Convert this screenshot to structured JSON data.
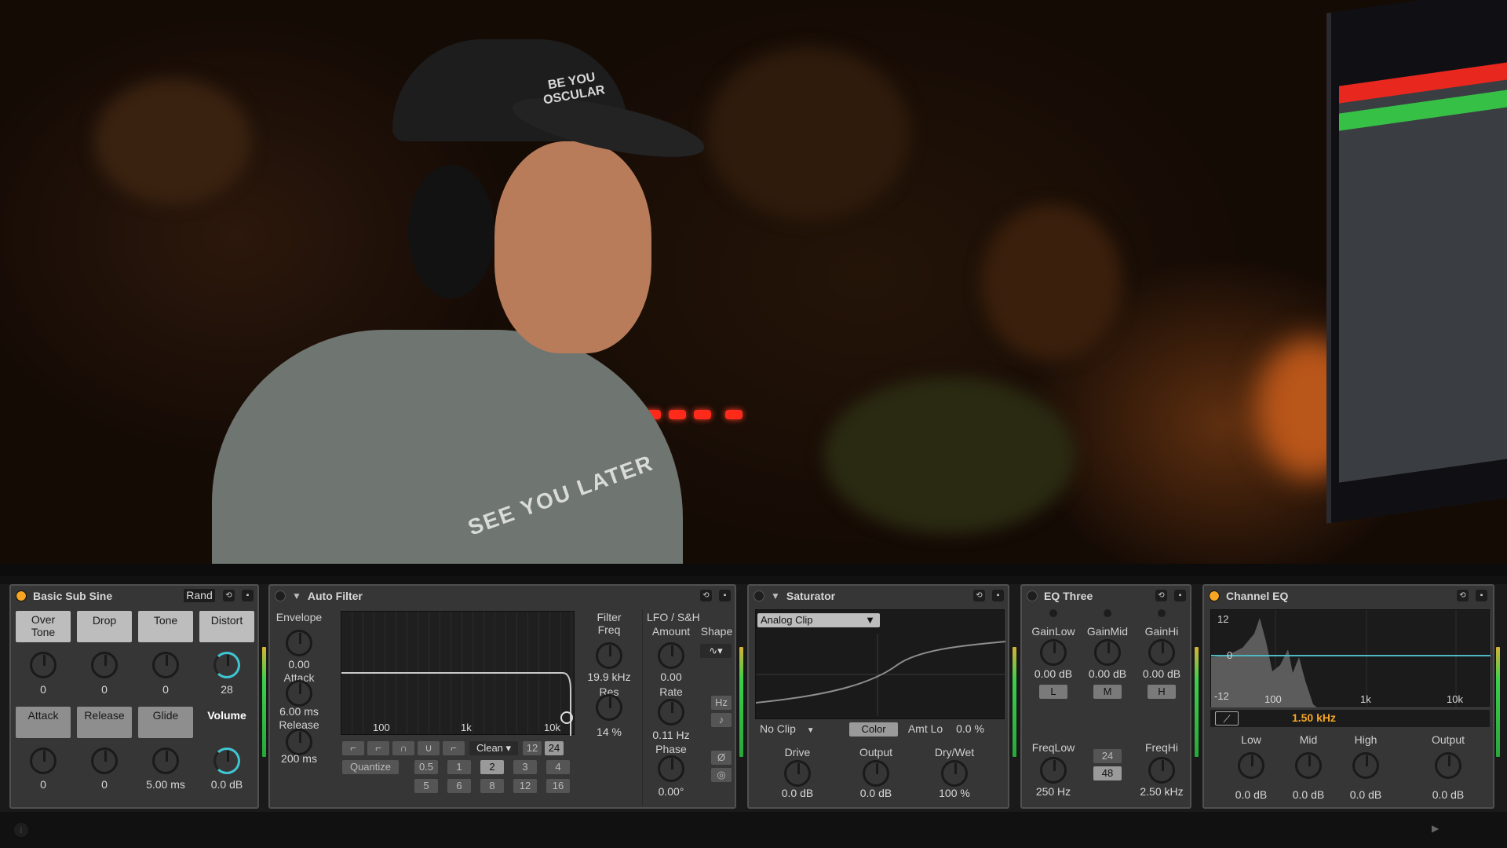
{
  "video": {
    "cap_text": "BE YOU\nOSCULAR",
    "shirt_text": "SEE YOU LATER"
  },
  "basic_sub_sine": {
    "title": "Basic Sub Sine",
    "rand_label": "Rand",
    "top_buttons": [
      {
        "label": "Over\nTone",
        "value": "0"
      },
      {
        "label": "Drop",
        "value": "0"
      },
      {
        "label": "Tone",
        "value": "0"
      },
      {
        "label": "Distort",
        "value": "28"
      }
    ],
    "bottom_buttons": [
      {
        "label": "Attack",
        "value": "0"
      },
      {
        "label": "Release",
        "value": "0"
      },
      {
        "label": "Glide",
        "value": "5.00 ms"
      },
      {
        "label": "Volume",
        "value": "0.0 dB"
      }
    ]
  },
  "auto_filter": {
    "title": "Auto Filter",
    "envelope_label": "Envelope",
    "envelope_value": "0.00",
    "attack_label": "Attack",
    "attack_value": "6.00 ms",
    "release_label": "Release",
    "release_value": "200 ms",
    "freq_ticks": [
      "100",
      "1k",
      "10k"
    ],
    "mode_label": "Clean",
    "slope_options": [
      "12",
      "24"
    ],
    "quantize_label": "Quantize",
    "quantize_row1": [
      "0.5",
      "1",
      "2",
      "3",
      "4"
    ],
    "quantize_row2": [
      "5",
      "6",
      "8",
      "12",
      "16"
    ],
    "filter_freq_label": "Filter\nFreq",
    "filter_freq_value": "19.9 kHz",
    "res_label": "Res",
    "res_value": "14 %",
    "lfo_label": "LFO / S&H",
    "amount_label": "Amount",
    "amount_value": "0.00",
    "shape_label": "Shape",
    "rate_label": "Rate",
    "rate_value": "0.11 Hz",
    "rate_unit": "Hz",
    "phase_label": "Phase",
    "phase_value": "0.00°"
  },
  "saturator": {
    "title": "Saturator",
    "curve_type": "Analog Clip",
    "no_clip_label": "No Clip",
    "color_label": "Color",
    "amt_lo_label": "Amt Lo",
    "amt_lo_value": "0.0 %",
    "drive_label": "Drive",
    "drive_value": "0.0 dB",
    "output_label": "Output",
    "output_value": "0.0 dB",
    "drywet_label": "Dry/Wet",
    "drywet_value": "100 %"
  },
  "eq_three": {
    "title": "EQ Three",
    "bands": [
      {
        "label": "GainLow",
        "value": "0.00 dB",
        "button": "L"
      },
      {
        "label": "GainMid",
        "value": "0.00 dB",
        "button": "M"
      },
      {
        "label": "GainHi",
        "value": "0.00 dB",
        "button": "H"
      }
    ],
    "freqlow_label": "FreqLow",
    "freqlow_value": "250 Hz",
    "freqhi_label": "FreqHi",
    "freqhi_value": "2.50 kHz",
    "slope_24": "24",
    "slope_48": "48"
  },
  "channel_eq": {
    "title": "Channel EQ",
    "y_ticks": [
      "12",
      "0",
      "-12"
    ],
    "x_ticks": [
      "100",
      "1k",
      "10k"
    ],
    "filter_freq": "1.50 kHz",
    "knobs": [
      {
        "label": "Low",
        "value": "0.0 dB"
      },
      {
        "label": "Mid",
        "value": "0.0 dB"
      },
      {
        "label": "High",
        "value": "0.0 dB"
      },
      {
        "label": "Output",
        "value": "0.0 dB"
      }
    ]
  },
  "colors": {
    "accent_orange": "#f6a623",
    "meter_green": "#3bd04b",
    "knob_cyan": "#3fc6d3",
    "channel_eq_line": "#4fb8c2"
  }
}
